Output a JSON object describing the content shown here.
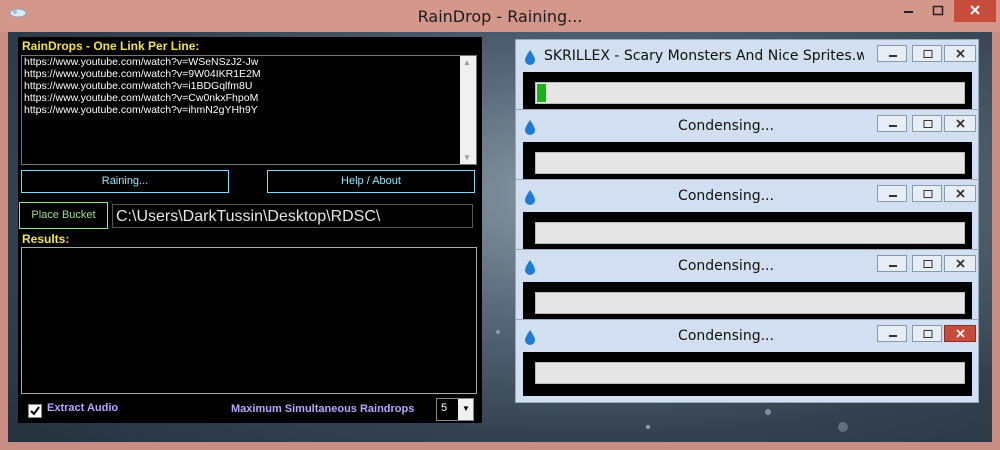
{
  "window": {
    "title": "RainDrop - Raining..."
  },
  "input": {
    "label": "RainDrops - One Link Per Line:",
    "links": [
      "https://www.youtube.com/watch?v=WSeNSzJ2-Jw",
      "https://www.youtube.com/watch?v=9W04IKR1E2M",
      "https://www.youtube.com/watch?v=i1BDGqlfm8U",
      "https://www.youtube.com/watch?v=Cw0nkxFhpoM",
      "https://www.youtube.com/watch?v=ihmN2gYHh9Y"
    ]
  },
  "buttons": {
    "raining": "Raining...",
    "help": "Help / About",
    "place_bucket": "Place Bucket"
  },
  "path": "C:\\Users\\DarkTussin\\Desktop\\RDSC\\",
  "results": {
    "label": "Results:"
  },
  "options": {
    "extract_audio": "Extract Audio",
    "extract_audio_checked": true,
    "max_label": "Maximum Simultaneous Raindrops",
    "max_value": "5"
  },
  "downloads": [
    {
      "title": "SKRILLEX - Scary Monsters And Nice Sprites.web...",
      "progress": 0.02
    },
    {
      "title": "Condensing...",
      "progress": 0
    },
    {
      "title": "Condensing...",
      "progress": 0
    },
    {
      "title": "Condensing...",
      "progress": 0
    },
    {
      "title": "Condensing...",
      "progress": 0
    }
  ],
  "colors": {
    "accent_yellow": "#f4e44a",
    "button_cyan": "#8fe8ff",
    "progress_green": "#17b417",
    "close_red": "#c74c3c"
  },
  "icons": {
    "app": "raindrop-app-icon",
    "drop": "water-drop-icon"
  }
}
